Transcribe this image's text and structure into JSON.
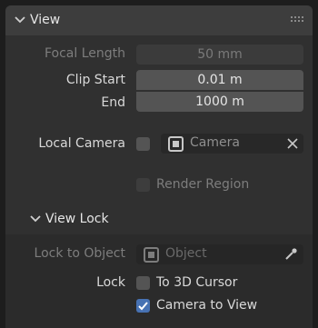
{
  "section": {
    "title": "View",
    "focal_length": {
      "label": "Focal Length",
      "value": "50 mm"
    },
    "clip_start": {
      "label": "Clip Start",
      "value": "0.01 m"
    },
    "clip_end": {
      "label": "End",
      "value": "1000 m"
    },
    "local_camera": {
      "label": "Local Camera",
      "checked": false,
      "value": "Camera"
    },
    "render_region": {
      "label": "Render Region",
      "checked": false
    }
  },
  "subsection": {
    "title": "View Lock",
    "lock_to_object": {
      "label": "Lock to Object",
      "placeholder": "Object"
    },
    "lock_label": "Lock",
    "to_3d_cursor": {
      "label": "To 3D Cursor",
      "checked": false
    },
    "camera_to_view": {
      "label": "Camera to View",
      "checked": true
    }
  },
  "colors": {
    "accent": "#4772b3",
    "panel": "#303030",
    "header": "#3d3d3d"
  },
  "icons": [
    "chevron-down-icon",
    "drag-grip-icon",
    "object-icon",
    "clear-x-icon",
    "eyedropper-icon",
    "checkmark-icon"
  ]
}
